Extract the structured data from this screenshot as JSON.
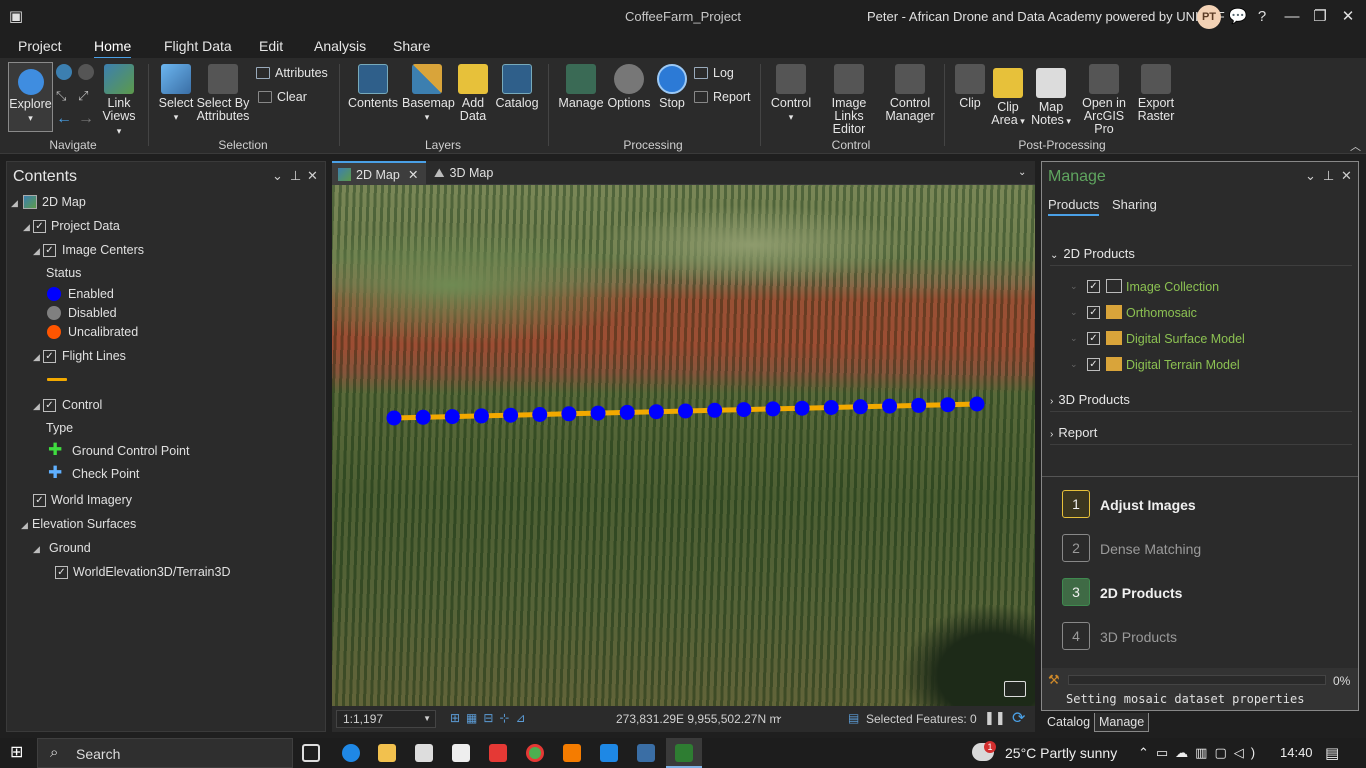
{
  "title": "CoffeeFarm_Project",
  "user": "Peter - African Drone and Data Academy powered by UNICEF",
  "avatar": "PT",
  "ribbon_tabs": [
    "Project",
    "Home",
    "Flight Data",
    "Edit",
    "Analysis",
    "Share"
  ],
  "ribbon": {
    "navigate": {
      "label": "Navigate",
      "explore": "Explore",
      "link_views_1": "Link",
      "link_views_2": "Views"
    },
    "selection": {
      "label": "Selection",
      "select": "Select",
      "select_by_1": "Select By",
      "select_by_2": "Attributes",
      "attributes": "Attributes",
      "clear": "Clear"
    },
    "layers": {
      "label": "Layers",
      "contents": "Contents",
      "basemap": "Basemap",
      "add_data_1": "Add",
      "add_data_2": "Data",
      "catalog": "Catalog"
    },
    "processing": {
      "label": "Processing",
      "manage": "Manage",
      "options": "Options",
      "stop": "Stop",
      "log": "Log",
      "report": "Report"
    },
    "control": {
      "label": "Control",
      "control": "Control",
      "image_links_1": "Image",
      "image_links_2": "Links Editor",
      "control_manager_1": "Control",
      "control_manager_2": "Manager"
    },
    "post": {
      "label": "Post-Processing",
      "clip": "Clip",
      "clip_area_1": "Clip",
      "clip_area_2": "Area",
      "map_notes_1": "Map",
      "map_notes_2": "Notes",
      "open_in_1": "Open in",
      "open_in_2": "ArcGIS Pro",
      "export_1": "Export",
      "export_2": "Raster"
    }
  },
  "contents": {
    "title": "Contents",
    "map": "2D Map",
    "project_data": "Project Data",
    "image_centers": "Image Centers",
    "status": "Status",
    "enabled": "Enabled",
    "disabled": "Disabled",
    "uncalibrated": "Uncalibrated",
    "flight_lines": "Flight Lines",
    "control": "Control",
    "type": "Type",
    "gcp": "Ground Control Point",
    "checkpoint": "Check Point",
    "world_imagery": "World Imagery",
    "elevation_surfaces": "Elevation Surfaces",
    "ground": "Ground",
    "terrain": "WorldElevation3D/Terrain3D"
  },
  "colors": {
    "enabled": "#0000ff",
    "disabled": "#808080",
    "uncalibrated": "#ff5500",
    "flight_line": "#f2a900",
    "accent": "#4aa0e6",
    "product": "#8cc152"
  },
  "map_tabs": [
    "2D Map",
    "3D Map"
  ],
  "status_bar": {
    "scale": "1:1,197",
    "coords": "273,831.29E 9,955,502.27N m",
    "selected": "Selected Features: 0"
  },
  "manage": {
    "title": "Manage",
    "tabs": [
      "Products",
      "Sharing"
    ],
    "sections": {
      "d2": "2D Products",
      "d3": "3D Products",
      "report": "Report"
    },
    "products": [
      "Image Collection",
      "Orthomosaic",
      "Digital Surface Model",
      "Digital Terrain Model"
    ],
    "steps": [
      {
        "n": "1",
        "label": "Adjust Images"
      },
      {
        "n": "2",
        "label": "Dense Matching"
      },
      {
        "n": "3",
        "label": "2D Products"
      },
      {
        "n": "4",
        "label": "3D Products"
      }
    ],
    "progress_pct": "0%",
    "progress_text": "Setting mosaic dataset properties"
  },
  "bottom_tabs": [
    "Catalog",
    "Manage"
  ],
  "taskbar": {
    "search": "Search",
    "weather": "25°C  Partly sunny",
    "time": "14:40",
    "notif": "1"
  }
}
